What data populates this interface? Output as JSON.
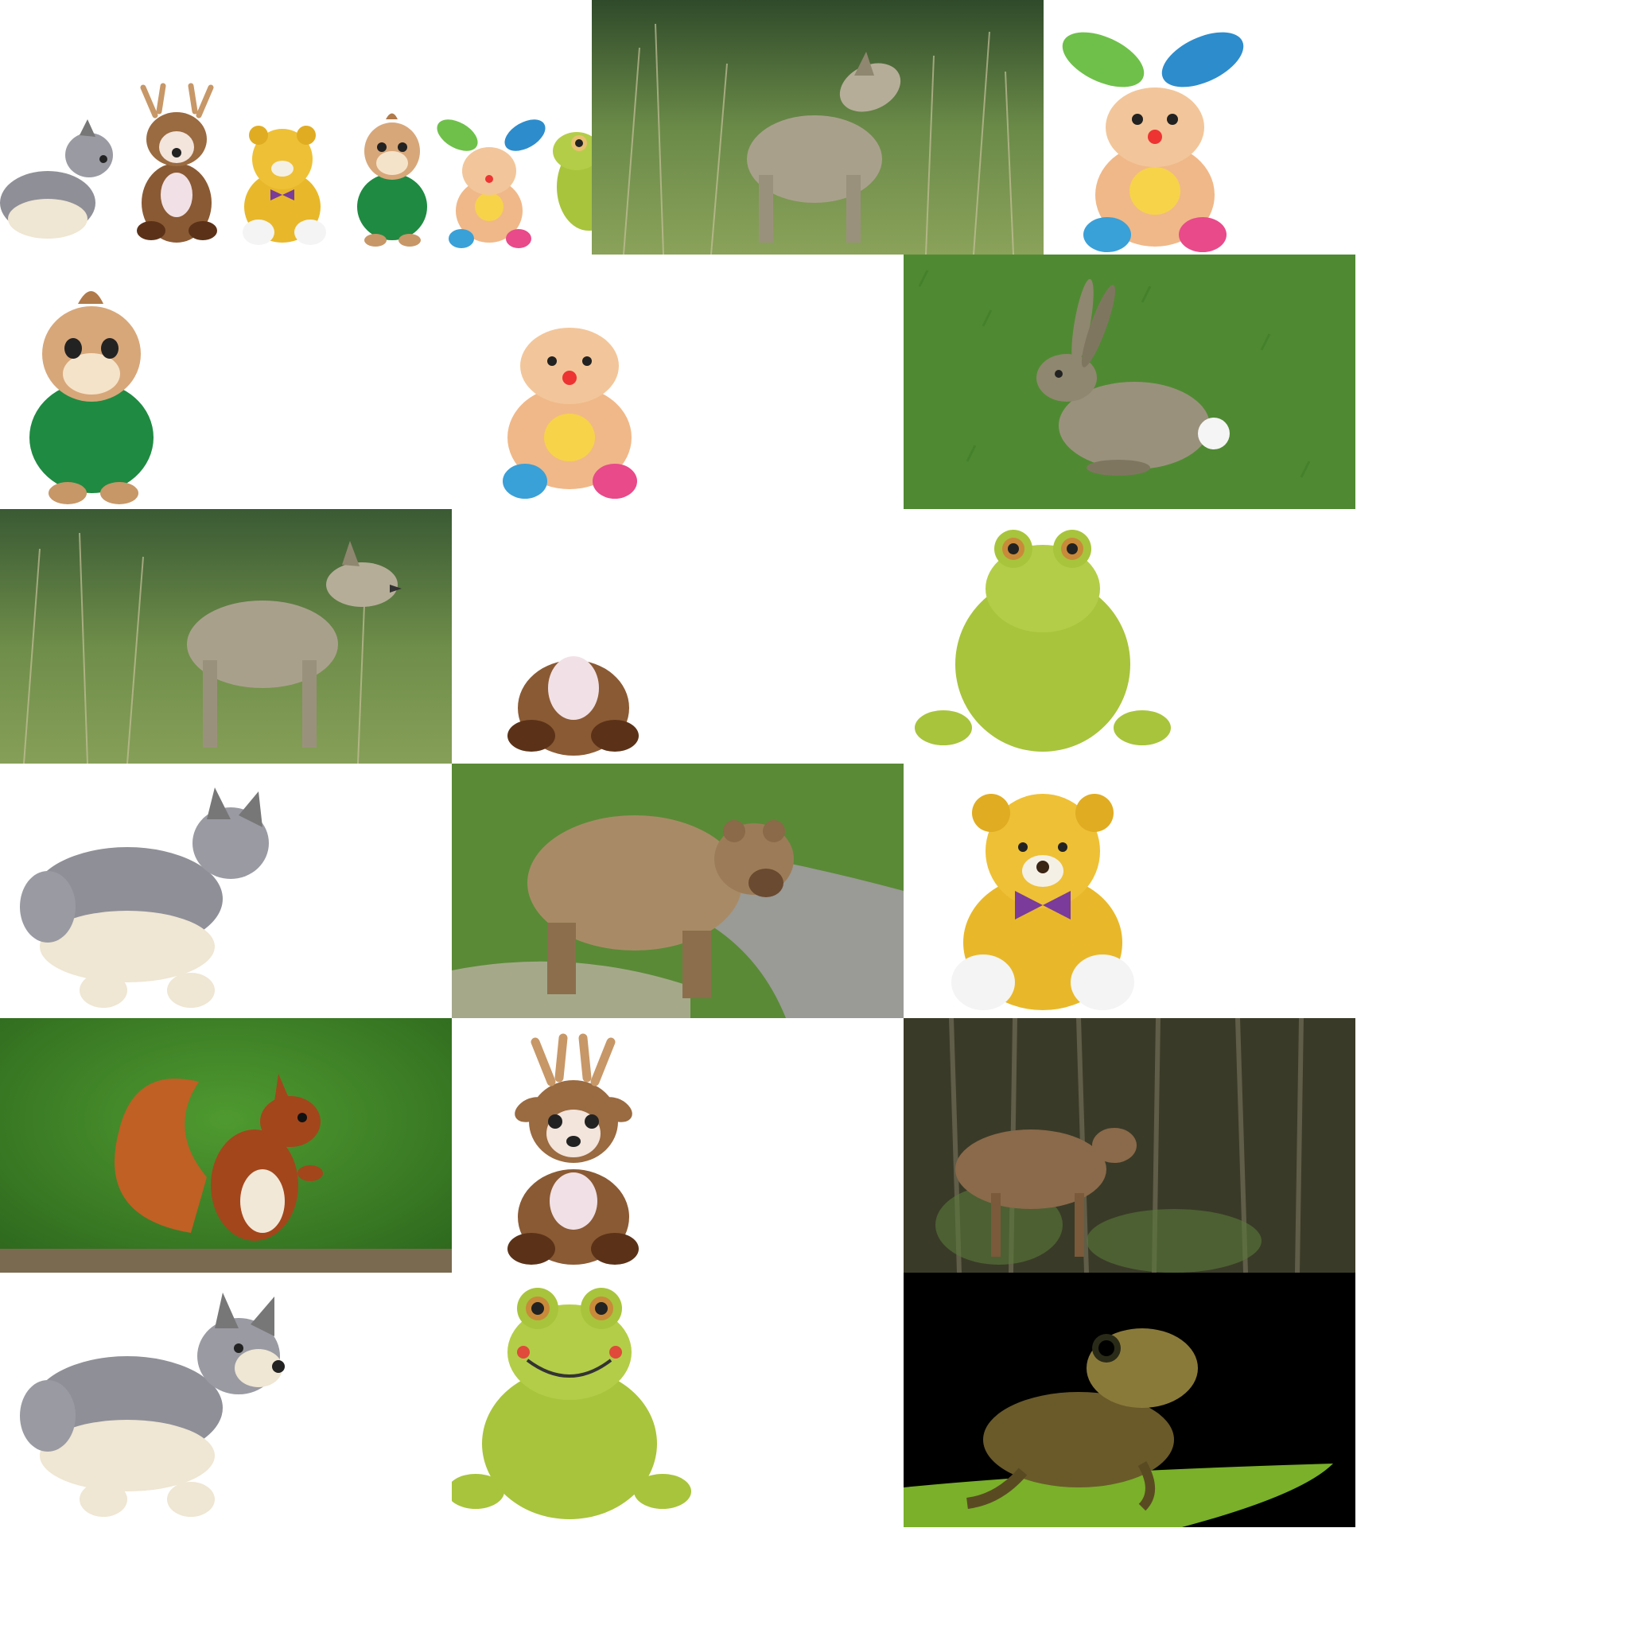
{
  "collage": {
    "background": "#ffffff",
    "tiles": [
      {
        "subject": "plush-lineup",
        "kind": "toy",
        "members": [
          "wolf",
          "deer",
          "teddy-bear",
          "chipmunk",
          "bunny",
          "frog"
        ]
      },
      {
        "subject": "wolf-howling",
        "kind": "photo"
      },
      {
        "subject": "bunny-plush",
        "kind": "toy"
      },
      {
        "subject": "chipmunk-plush",
        "kind": "toy"
      },
      {
        "subject": "bunny-plush-no-ears",
        "kind": "toy"
      },
      {
        "subject": "hare",
        "kind": "photo"
      },
      {
        "subject": "wolf-standing",
        "kind": "photo"
      },
      {
        "subject": "deer-plush-body",
        "kind": "toy"
      },
      {
        "subject": "frog-plush-no-mouth",
        "kind": "toy"
      },
      {
        "subject": "wolf-plush-no-face",
        "kind": "toy"
      },
      {
        "subject": "brown-bear",
        "kind": "photo"
      },
      {
        "subject": "teddy-bear-plush",
        "kind": "toy"
      },
      {
        "subject": "red-squirrel",
        "kind": "photo"
      },
      {
        "subject": "deer-plush",
        "kind": "toy"
      },
      {
        "subject": "deer-in-forest",
        "kind": "photo"
      },
      {
        "subject": "wolf-plush",
        "kind": "toy"
      },
      {
        "subject": "frog-plush",
        "kind": "toy"
      },
      {
        "subject": "frog",
        "kind": "photo"
      }
    ]
  },
  "colors": {
    "grass": "#5f8a3a",
    "forest": "#3f5e2f",
    "wolf_gray": "#a9a08c",
    "frog_toy": "#a8c43c",
    "teddy": "#e8b82a",
    "deer_brown": "#8a5a34",
    "squirrel": "#a3461c",
    "night": "#000000"
  }
}
